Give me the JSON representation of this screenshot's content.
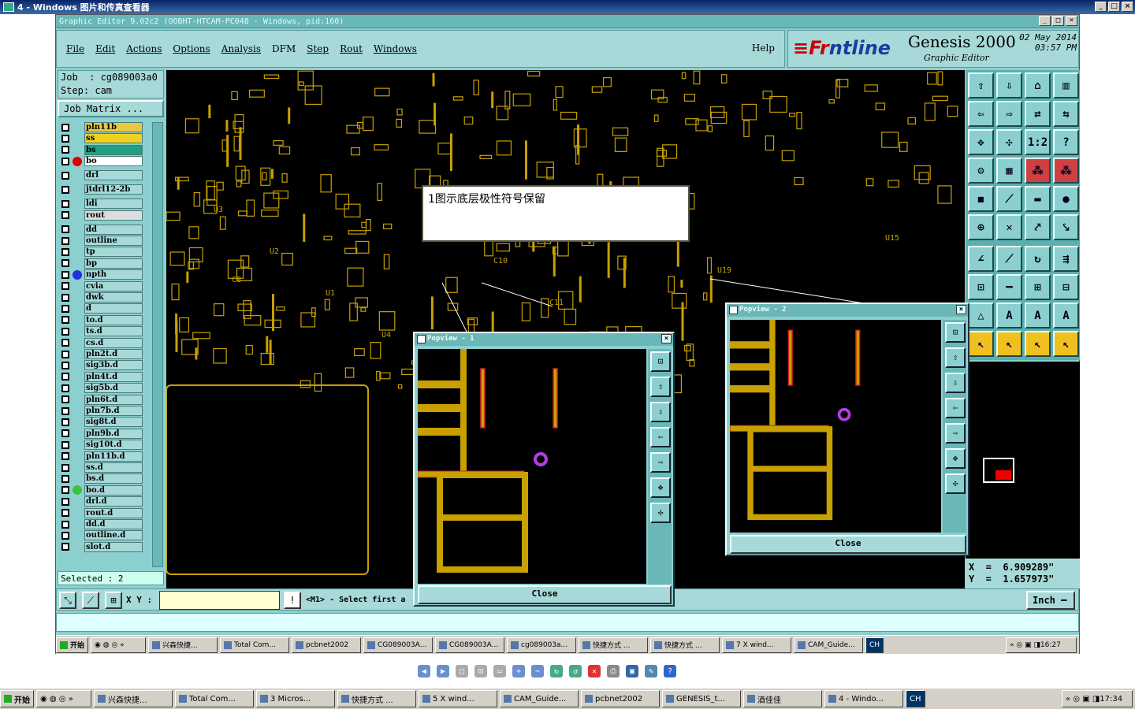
{
  "outer_window": {
    "title": "4 - Windows 图片和传真查看器"
  },
  "app": {
    "title": "Graphic Editor 9.02c2 (OOBHT-HTCAM-PC048 - Windows, pid:160)",
    "menu": [
      "File",
      "Edit",
      "Actions",
      "Options",
      "Analysis",
      "DFM",
      "Step",
      "Rout",
      "Windows"
    ],
    "help": "Help",
    "brand": {
      "logo_prefix": "≡Fr",
      "logo_rest": "ntline",
      "product": "Genesis 2000",
      "subtitle": "Graphic Editor",
      "date": "02 May 2014",
      "time": "03:57 PM"
    },
    "job_label": "Job  : cg089003a0",
    "step_label": "Step: cam",
    "job_matrix": "Job Matrix ...",
    "layers": [
      {
        "name": "pln11b",
        "color": "#e8c840",
        "dot": ""
      },
      {
        "name": "ss",
        "color": "#f0d020",
        "dot": ""
      },
      {
        "name": "bs",
        "color": "#20a080",
        "dot": ""
      },
      {
        "name": "bo",
        "color": "#ffffff",
        "dot": "#e00000"
      },
      {
        "name": "drl",
        "color": "#a7d9d9",
        "dot": ""
      },
      {
        "name": "jtdrl12-2b",
        "color": "#a7d9d9",
        "dot": ""
      },
      {
        "name": "ldi",
        "color": "#a7d9d9",
        "dot": ""
      },
      {
        "name": "rout",
        "color": "#dddddd",
        "dot": ""
      },
      {
        "name": "dd",
        "color": "#a7d9d9",
        "dot": ""
      },
      {
        "name": "outline",
        "color": "#a7d9d9",
        "dot": ""
      },
      {
        "name": "tp",
        "color": "#a7d9d9",
        "dot": ""
      },
      {
        "name": "bp",
        "color": "#a7d9d9",
        "dot": ""
      },
      {
        "name": "npth",
        "color": "#a7d9d9",
        "dot": "#2030e0"
      },
      {
        "name": "cvia",
        "color": "#a7d9d9",
        "dot": ""
      },
      {
        "name": "dwk",
        "color": "#a7d9d9",
        "dot": ""
      },
      {
        "name": "d",
        "color": "#a7d9d9",
        "dot": ""
      },
      {
        "name": "to.d",
        "color": "#a7d9d9",
        "dot": ""
      },
      {
        "name": "ts.d",
        "color": "#a7d9d9",
        "dot": ""
      },
      {
        "name": "cs.d",
        "color": "#a7d9d9",
        "dot": ""
      },
      {
        "name": "pln2t.d",
        "color": "#a7d9d9",
        "dot": ""
      },
      {
        "name": "sig3b.d",
        "color": "#a7d9d9",
        "dot": ""
      },
      {
        "name": "pln4t.d",
        "color": "#a7d9d9",
        "dot": ""
      },
      {
        "name": "sig5b.d",
        "color": "#a7d9d9",
        "dot": ""
      },
      {
        "name": "pln6t.d",
        "color": "#a7d9d9",
        "dot": ""
      },
      {
        "name": "pln7b.d",
        "color": "#a7d9d9",
        "dot": ""
      },
      {
        "name": "sig8t.d",
        "color": "#a7d9d9",
        "dot": ""
      },
      {
        "name": "pln9b.d",
        "color": "#a7d9d9",
        "dot": ""
      },
      {
        "name": "sig10t.d",
        "color": "#a7d9d9",
        "dot": ""
      },
      {
        "name": "pln11b.d",
        "color": "#a7d9d9",
        "dot": ""
      },
      {
        "name": "ss.d",
        "color": "#a7d9d9",
        "dot": ""
      },
      {
        "name": "bs.d",
        "color": "#a7d9d9",
        "dot": ""
      },
      {
        "name": "bo.d",
        "color": "#a7d9d9",
        "dot": "#40c040"
      },
      {
        "name": "drl.d",
        "color": "#a7d9d9",
        "dot": ""
      },
      {
        "name": "rout.d",
        "color": "#a7d9d9",
        "dot": ""
      },
      {
        "name": "dd.d",
        "color": "#a7d9d9",
        "dot": ""
      },
      {
        "name": "outline.d",
        "color": "#a7d9d9",
        "dot": ""
      },
      {
        "name": "slot.d",
        "color": "#a7d9d9",
        "dot": ""
      }
    ],
    "selected": "Selected : 2",
    "xy_label": "X Y :",
    "message": "<M1> - Select first a",
    "unit": "Inch",
    "coords": {
      "x": "X  =  6.909289\"",
      "y": "Y  =  1.657973\""
    },
    "annotation": "1图示底层极性符号保留",
    "popview1": {
      "title": "Popview - 1",
      "close": "Close"
    },
    "popview2": {
      "title": "Popview - 2",
      "close": "Close"
    },
    "canvas_labels": [
      "U3",
      "U2",
      "U1",
      "U4",
      "C9",
      "C10",
      "C11",
      "U14",
      "U18",
      "U19",
      "U20",
      "C1",
      "U15",
      "C8"
    ]
  },
  "app_taskbar": {
    "start": "开始",
    "items": [
      "兴森快捷...",
      "Total Com...",
      "pcbnet2002",
      "CG089003A...",
      "CG089003A...",
      "cg089003a...",
      "快捷方式 ...",
      "快捷方式 ...",
      "7 X wind...",
      "CAM_Guide..."
    ],
    "lang": "CH",
    "clock": "16:27"
  },
  "os_taskbar": {
    "start": "开始",
    "items": [
      "兴森快捷...",
      "Total Com...",
      "3 Micros...",
      "快捷方式 ...",
      "5 X wind...",
      "CAM_Guide...",
      "pcbnet2002",
      "GENESIS_t...",
      "酒佳佳",
      "4 - Windo..."
    ],
    "lang": "CH",
    "clock": "17:34"
  },
  "colors": {
    "app_bg": "#8ccfcf",
    "pcb_yellow": "#c8a000",
    "pcb_red": "#d82020"
  }
}
